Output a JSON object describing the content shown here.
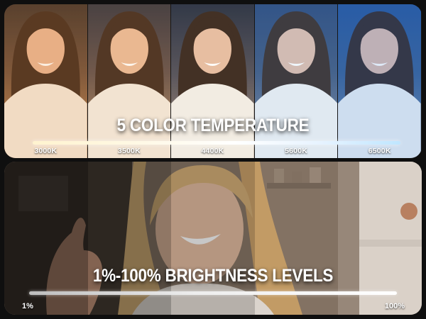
{
  "color_temperature": {
    "title": "5 COLOR TEMPERATURE",
    "levels": [
      {
        "label": "3000K",
        "tint": "#e8a35a"
      },
      {
        "label": "3500K",
        "tint": "#efbb7a"
      },
      {
        "label": "4400K",
        "tint": "#f3d6b0"
      },
      {
        "label": "5600K",
        "tint": "#9cc4ea"
      },
      {
        "label": "6500K",
        "tint": "#5c93d8"
      }
    ]
  },
  "brightness": {
    "title": "1%-100% BRIGHTNESS LEVELS",
    "min_label": "1%",
    "max_label": "100%"
  },
  "colors": {
    "text": "#ffffff",
    "background": "#0f0f0f"
  }
}
